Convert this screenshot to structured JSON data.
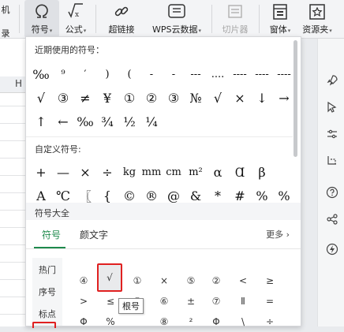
{
  "ribbon": {
    "partial_label": "录",
    "partial_label_top": "机",
    "symbol_label": "符号",
    "formula_label": "公式",
    "hyperlink_label": "超链接",
    "wps_cloud_label": "WPS云数据",
    "slicer_label": "切片器",
    "window_label": "窗体",
    "resource_label": "资源夹"
  },
  "sheet": {
    "column_header": "H"
  },
  "panel": {
    "recent_title": "近期使用的符号：",
    "recent_rows": [
      [
        "‰",
        "⁹",
        "′",
        ")",
        "(",
        "-",
        "-",
        "---",
        "....",
        "----",
        "----",
        "----"
      ],
      [
        "√",
        "③",
        "≠",
        "¥",
        "①",
        "②",
        "③",
        "№",
        "√",
        "×",
        "↓",
        "→"
      ],
      [
        "↑",
        "←",
        "‰",
        "¾",
        "½",
        "¼"
      ]
    ],
    "custom_title": "自定义符号:",
    "custom_rows": [
      [
        "+",
        "—",
        "×",
        "÷",
        "kg",
        "mm",
        "cm",
        "m²",
        "α",
        "Ɑ",
        "β"
      ],
      [
        "Α",
        "℃",
        "〖",
        "{",
        "©",
        "®",
        "@",
        "&",
        "*",
        "#",
        "%",
        "%"
      ]
    ],
    "gallery_title": "符号大全",
    "tabs": [
      "符号",
      "颜文字"
    ],
    "more_label": "更多",
    "categories": [
      "热门",
      "序号",
      "标点"
    ],
    "symbol_rows": [
      [
        "④",
        "√",
        "①",
        "×",
        "⑤",
        "②",
        "<",
        "≥"
      ],
      [
        ">",
        "≤",
        "③",
        "⑥",
        "±",
        "⑦",
        "Ⅱ",
        "="
      ],
      [
        "Φ",
        "%",
        "",
        "⑧",
        "²",
        "Φ",
        "\\",
        "÷"
      ]
    ],
    "tooltip": "根号"
  },
  "colors": {
    "accent": "#1e8a4c",
    "highlight": "#e02020"
  }
}
